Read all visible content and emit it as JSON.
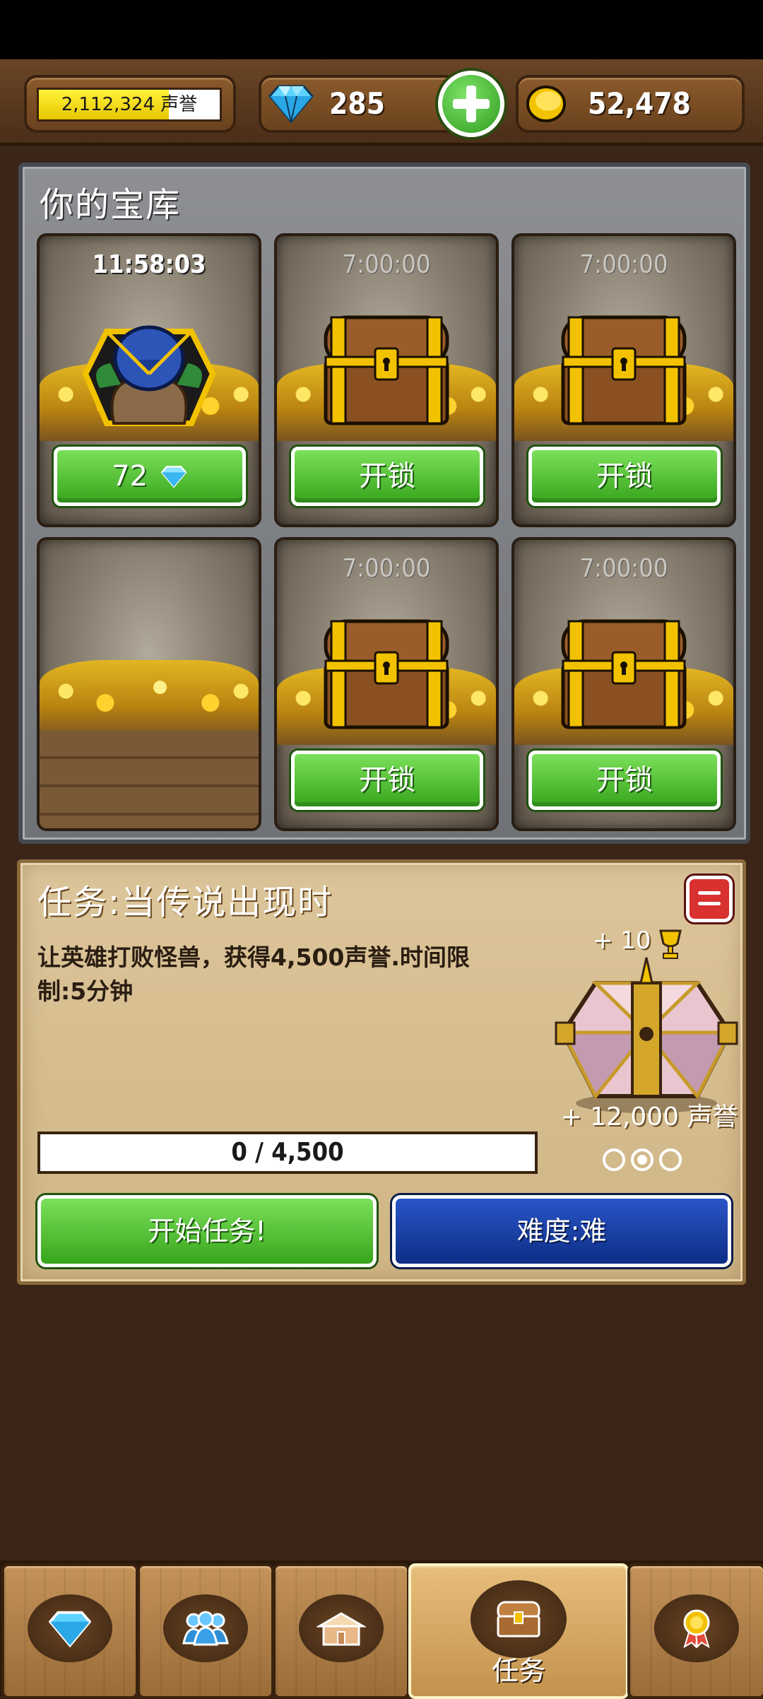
{
  "header": {
    "prestige": {
      "value": "2,112,324",
      "unit": "声誉",
      "fill_fraction": 0.72
    },
    "gems": "285",
    "gold": "52,478"
  },
  "vault": {
    "title": "你的宝库",
    "slots": [
      {
        "timer": "11:58:03",
        "chest": "rare-chest",
        "button": "72",
        "button_icon": "gem-icon"
      },
      {
        "timer": "7:00:00",
        "chest": "wooden-chest",
        "button": "开锁"
      },
      {
        "timer": "7:00:00",
        "chest": "wooden-chest",
        "button": "开锁"
      },
      {
        "empty": true
      },
      {
        "timer": "7:00:00",
        "chest": "wooden-chest",
        "button": "开锁"
      },
      {
        "timer": "7:00:00",
        "chest": "wooden-chest",
        "button": "开锁"
      }
    ]
  },
  "quest": {
    "title": "任务:当传说出现时",
    "description_line1": "让英雄打败怪兽，获得4,500声誉.时间限",
    "description_line2": "制:5分钟",
    "reward_trophies": "+ 10",
    "reward_prestige": "+ 12,000 声誉",
    "progress_text": "0 / 4,500",
    "progress_fraction": 0,
    "start_label": "开始任务!",
    "difficulty_label": "难度:难"
  },
  "nav": {
    "tabs": [
      {
        "icon": "gem-icon"
      },
      {
        "icon": "heroes-icon"
      },
      {
        "icon": "buildings-icon"
      },
      {
        "icon": "chest-icon",
        "label": "任务",
        "active": true
      },
      {
        "icon": "medal-icon"
      }
    ]
  },
  "colors": {
    "button_green": "#37a51c",
    "button_blue": "#0d2e86",
    "gold": "#f2c200"
  }
}
